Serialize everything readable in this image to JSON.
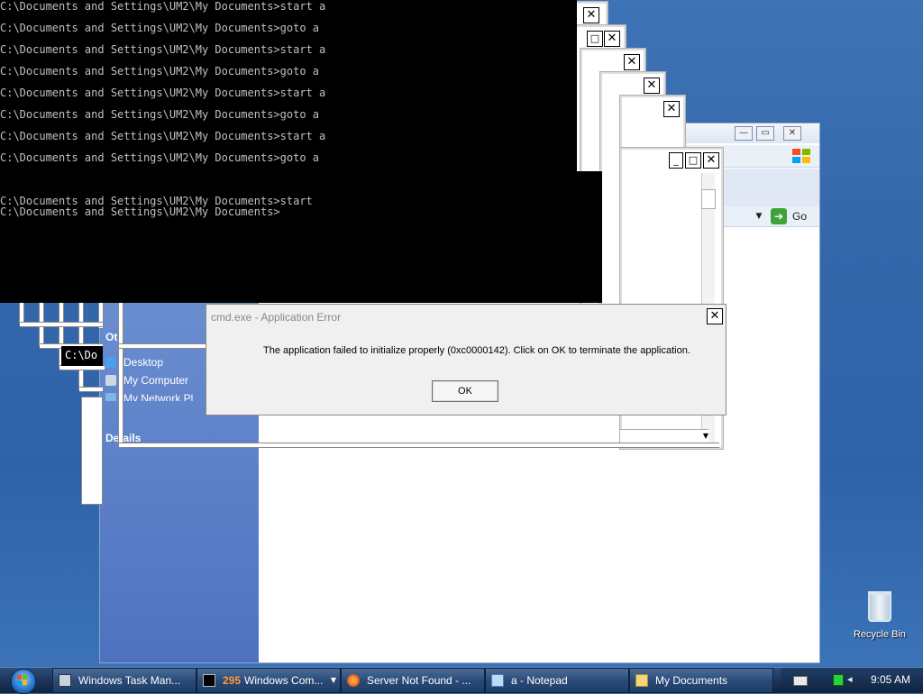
{
  "console": {
    "lines": [
      "C:\\Documents and Settings\\UM2\\My Documents>start a",
      "C:\\Documents and Settings\\UM2\\My Documents>goto a",
      "C:\\Documents and Settings\\UM2\\My Documents>start a",
      "C:\\Documents and Settings\\UM2\\My Documents>goto a",
      "C:\\Documents and Settings\\UM2\\My Documents>start a",
      "C:\\Documents and Settings\\UM2\\My Documents>goto a",
      "C:\\Documents and Settings\\UM2\\My Documents>start a",
      "C:\\Documents and Settings\\UM2\\My Documents>goto a",
      "C:\\Documents and Settings\\UM2\\My Documents>start",
      "C:\\Documents and Settings\\UM2\\My Documents>"
    ],
    "partial_label": "C:\\Do"
  },
  "explorer": {
    "go_label": "Go",
    "tasks_header_partial": "Ot",
    "tasks": [
      "Desktop",
      "My Computer",
      "My Network Pl"
    ],
    "details_label": "Details",
    "dropdown_glyph": "▼",
    "go_arrow_glyph": "➔"
  },
  "ghost_windows": {
    "close_glyph": "✕",
    "max_glyph": "□",
    "min_glyph": "_",
    "scroll_up_glyph": "▲",
    "scroll_down_glyph": "▼"
  },
  "dialog": {
    "title": "cmd.exe - Application Error",
    "message": "The application failed to initialize properly (0xc0000142). Click on OK to terminate the application.",
    "ok_label": "OK",
    "close_glyph": "✕"
  },
  "desktop": {
    "recycle_bin_label": "Recycle Bin"
  },
  "taskbar": {
    "items": [
      {
        "label": "Windows Task Man...",
        "icon": "task-manager-icon"
      },
      {
        "count": "295",
        "label": "Windows Com...",
        "icon": "cmd-icon"
      },
      {
        "label": "Server Not Found - ...",
        "icon": "firefox-icon"
      },
      {
        "label": "a - Notepad",
        "icon": "notepad-icon"
      },
      {
        "label": "My Documents",
        "icon": "folder-icon"
      }
    ],
    "drop_glyph": "▼",
    "clock": "9:05 AM"
  },
  "colors": {
    "desktop": "#3567ab",
    "console_bg": "#000000",
    "console_fg": "#c0c0c0",
    "tasks_pane": "#5278c4",
    "taskbar": "#1b3558",
    "go_green": "#3fa33c",
    "count_orange": "#ff9a3c"
  }
}
